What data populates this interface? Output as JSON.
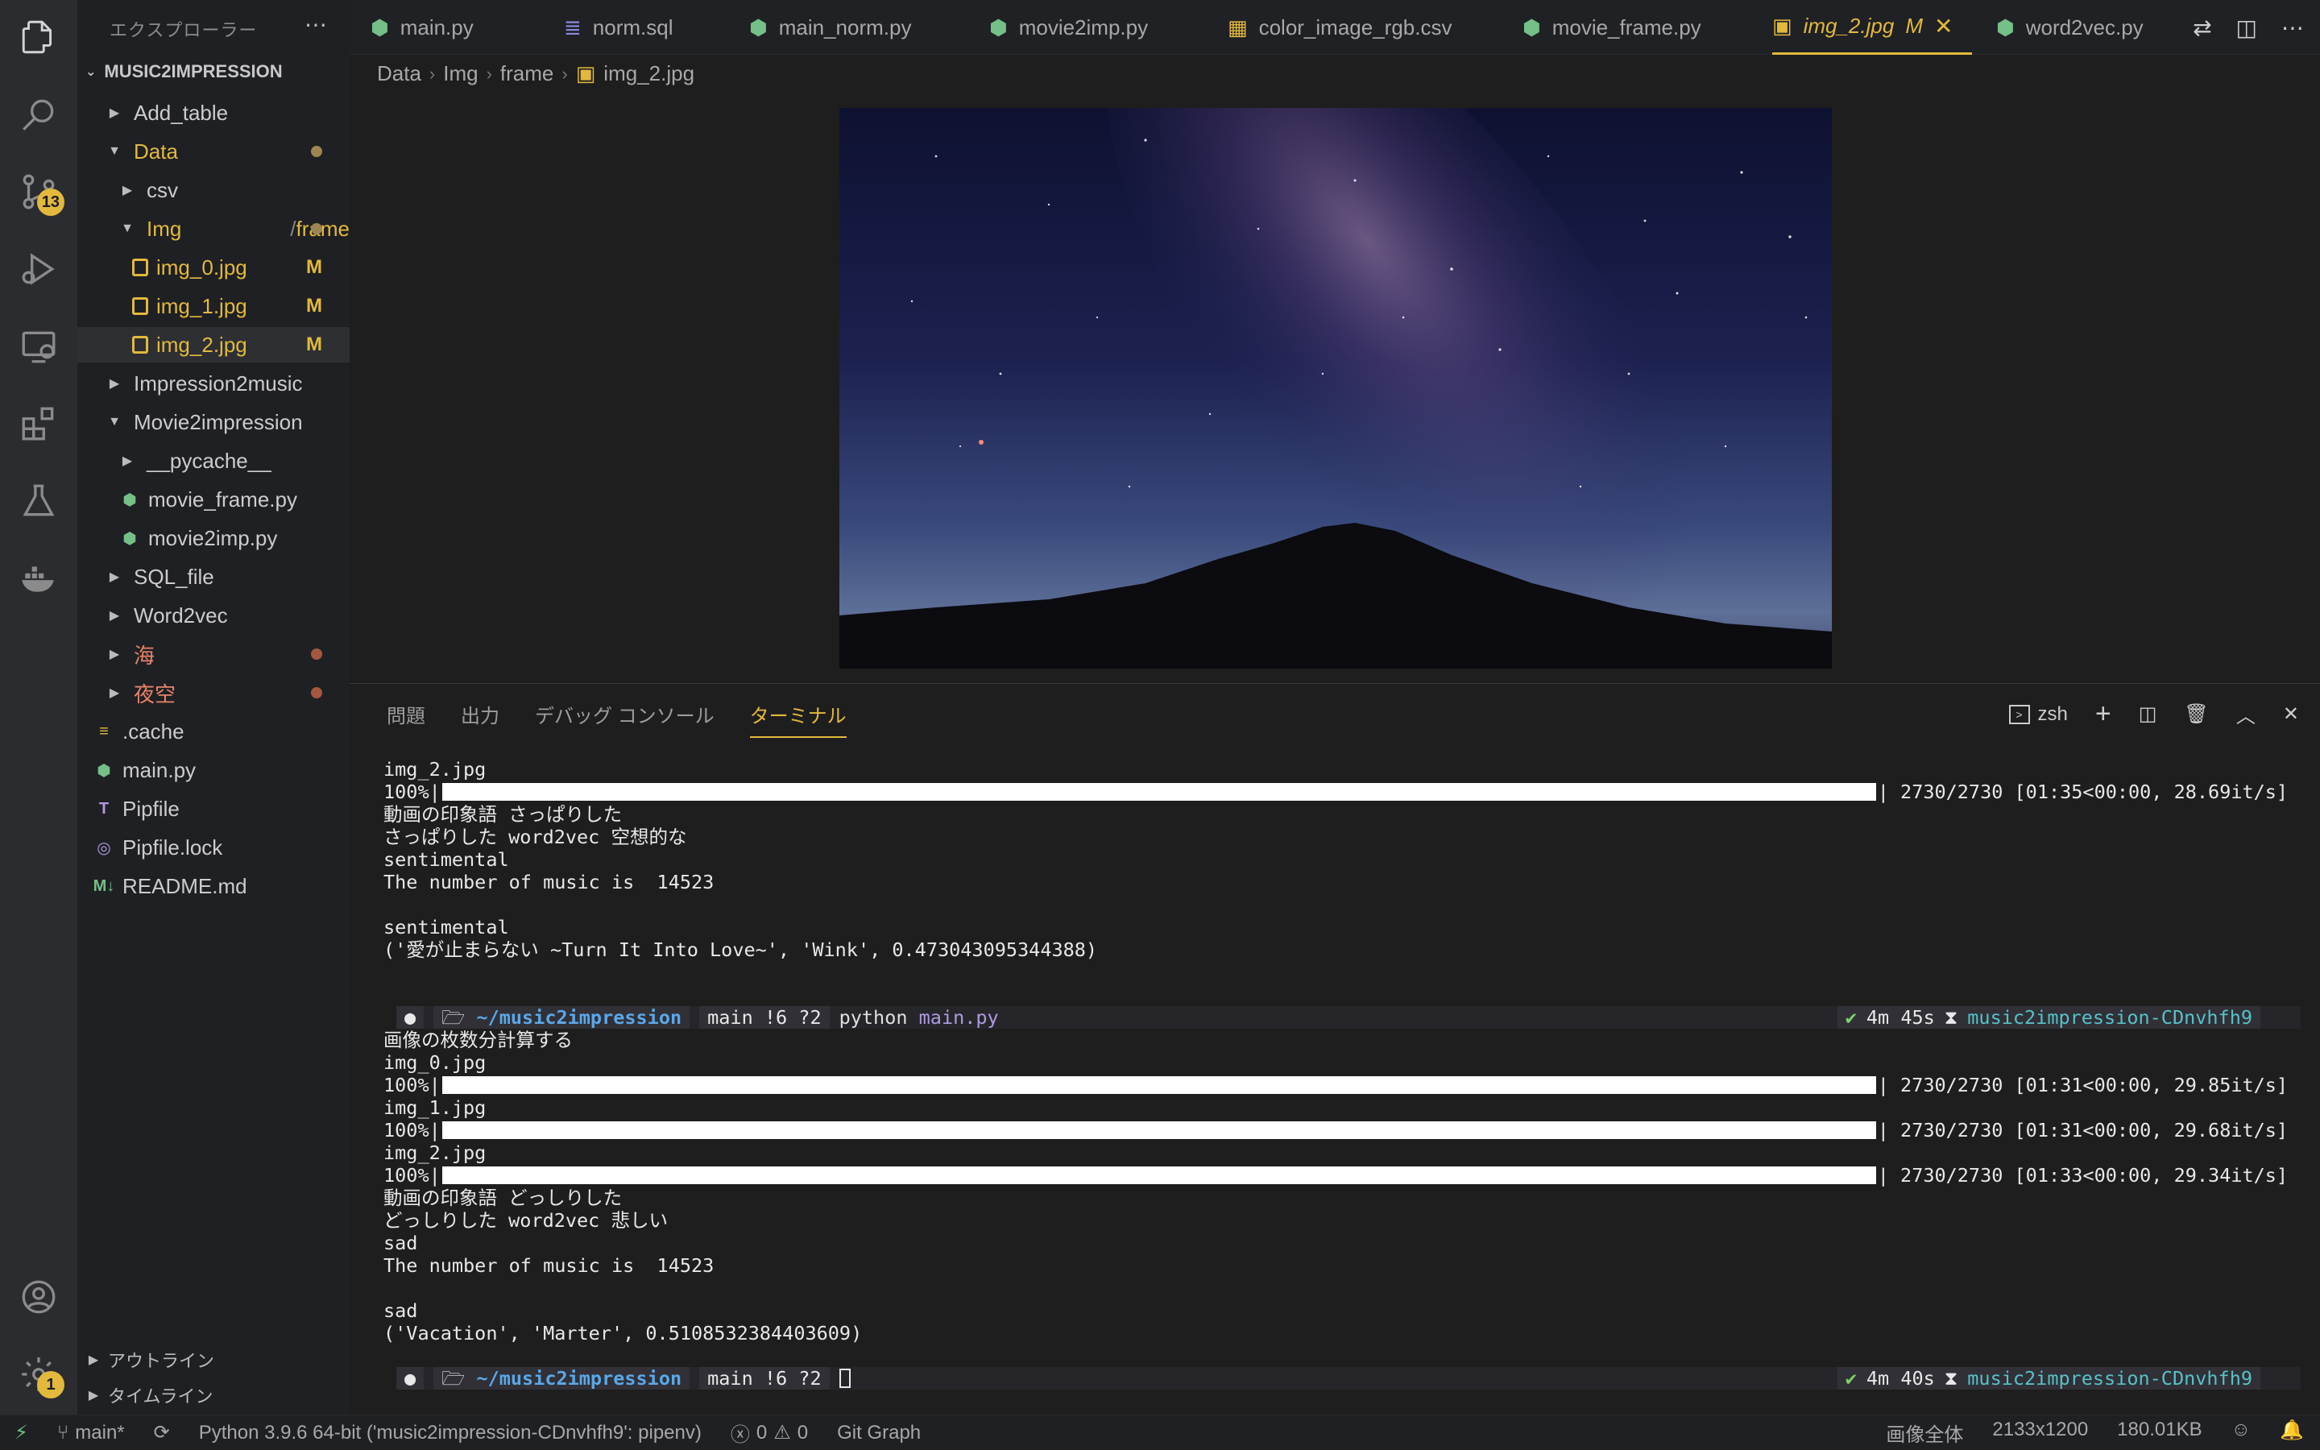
{
  "explorer": {
    "title": "エクスプローラー",
    "root": "MUSIC2IMPRESSION",
    "items": [
      {
        "label": "Add_table",
        "kind": "folder",
        "open": false
      },
      {
        "label": "Data",
        "kind": "folder",
        "open": true,
        "status": "dot"
      },
      {
        "label": "csv",
        "kind": "folder",
        "open": false
      },
      {
        "label": "Img",
        "label2": "frame",
        "kind": "folder",
        "open": true,
        "status": "dot"
      },
      {
        "label": "img_0.jpg",
        "kind": "image",
        "status": "M"
      },
      {
        "label": "img_1.jpg",
        "kind": "image",
        "status": "M"
      },
      {
        "label": "img_2.jpg",
        "kind": "image",
        "status": "M"
      },
      {
        "label": "Impression2music",
        "kind": "folder",
        "open": false
      },
      {
        "label": "Movie2impression",
        "kind": "folder",
        "open": true
      },
      {
        "label": "__pycache__",
        "kind": "folder",
        "open": false
      },
      {
        "label": "movie_frame.py",
        "kind": "python"
      },
      {
        "label": "movie2imp.py",
        "kind": "python"
      },
      {
        "label": "SQL_file",
        "kind": "folder",
        "open": false
      },
      {
        "label": "Word2vec",
        "kind": "folder",
        "open": false
      },
      {
        "label": "海",
        "kind": "folder",
        "open": false,
        "status": "dot"
      },
      {
        "label": "夜空",
        "kind": "folder",
        "open": false,
        "status": "dot"
      },
      {
        "label": ".cache",
        "kind": "file"
      },
      {
        "label": "main.py",
        "kind": "python"
      },
      {
        "label": "Pipfile",
        "kind": "pipfile"
      },
      {
        "label": "Pipfile.lock",
        "kind": "lock"
      },
      {
        "label": "README.md",
        "kind": "markdown"
      }
    ],
    "outline": "アウトライン",
    "timeline": "タイムライン"
  },
  "activity": {
    "icons": [
      "files-icon",
      "search-icon",
      "source-control-icon",
      "run-debug-icon",
      "remote-explorer-icon",
      "extensions-icon",
      "testing-icon",
      "docker-icon"
    ],
    "scm_badge": "13",
    "settings_badge": "1"
  },
  "tabs": [
    {
      "label": "main.py",
      "icon": "python"
    },
    {
      "label": "norm.sql",
      "icon": "database"
    },
    {
      "label": "main_norm.py",
      "icon": "python"
    },
    {
      "label": "movie2imp.py",
      "icon": "python"
    },
    {
      "label": "color_image_rgb.csv",
      "icon": "table"
    },
    {
      "label": "movie_frame.py",
      "icon": "python"
    },
    {
      "label": "img_2.jpg",
      "icon": "image",
      "active": true,
      "badge": "M"
    },
    {
      "label": "word2vec.py",
      "icon": "python"
    }
  ],
  "breadcrumb": [
    "Data",
    "Img",
    "frame",
    "img_2.jpg"
  ],
  "panel": {
    "tabs": [
      "問題",
      "出力",
      "デバッグ コンソール",
      "ターミナル"
    ],
    "shell": "zsh"
  },
  "terminal": {
    "lines": [
      {
        "t": "text",
        "v": "img_2.jpg"
      },
      {
        "t": "bar",
        "pct": "100%|",
        "tail": "| 2730/2730 [01:35<00:00, 28.69it/s]"
      },
      {
        "t": "text",
        "v": "動画の印象語 さっぱりした"
      },
      {
        "t": "text",
        "v": "さっぱりした word2vec 空想的な"
      },
      {
        "t": "text",
        "v": "sentimental"
      },
      {
        "t": "text",
        "v": "The number of music is  14523"
      },
      {
        "t": "text",
        "v": ""
      },
      {
        "t": "text",
        "v": "sentimental"
      },
      {
        "t": "text",
        "v": "('愛が止まらない ~Turn It Into Love~', 'Wink', 0.473043095344388)"
      },
      {
        "t": "text",
        "v": ""
      },
      {
        "t": "text",
        "v": ""
      },
      {
        "t": "prompt",
        "path": "~/music2impression",
        "branch": "main !6 ?2",
        "cmd": "python",
        "arg": "main.py",
        "time": "4m 45s",
        "venv": "music2impression-CDnvhfh9"
      },
      {
        "t": "text",
        "v": "画像の枚数分計算する"
      },
      {
        "t": "text",
        "v": "img_0.jpg"
      },
      {
        "t": "bar",
        "pct": "100%|",
        "tail": "| 2730/2730 [01:31<00:00, 29.85it/s]"
      },
      {
        "t": "text",
        "v": "img_1.jpg"
      },
      {
        "t": "bar",
        "pct": "100%|",
        "tail": "| 2730/2730 [01:31<00:00, 29.68it/s]"
      },
      {
        "t": "text",
        "v": "img_2.jpg"
      },
      {
        "t": "bar",
        "pct": "100%|",
        "tail": "| 2730/2730 [01:33<00:00, 29.34it/s]"
      },
      {
        "t": "text",
        "v": "動画の印象語 どっしりした"
      },
      {
        "t": "text",
        "v": "どっしりした word2vec 悲しい"
      },
      {
        "t": "text",
        "v": "sad"
      },
      {
        "t": "text",
        "v": "The number of music is  14523"
      },
      {
        "t": "text",
        "v": ""
      },
      {
        "t": "text",
        "v": "sad"
      },
      {
        "t": "text",
        "v": "('Vacation', 'Marter', 0.5108532384403609)"
      },
      {
        "t": "text",
        "v": ""
      },
      {
        "t": "prompt",
        "path": "~/music2impression",
        "branch": "main !6 ?2",
        "cmd": "",
        "arg": "",
        "time": "4m 40s",
        "venv": "music2impression-CDnvhfh9",
        "cursor": true
      }
    ]
  },
  "statusbar": {
    "branch": "main*",
    "python": "Python 3.9.6 64-bit ('music2impression-CDnvhfh9': pipenv)",
    "errors": "0",
    "warnings": "0",
    "git_graph": "Git Graph",
    "image_mode": "画像全体",
    "dimensions": "2133x1200",
    "size": "180.01KB"
  },
  "colors": {
    "accent": "#e2b93d",
    "modified": "#e2c08d",
    "error": "#e8836a",
    "python": "#74c088"
  }
}
